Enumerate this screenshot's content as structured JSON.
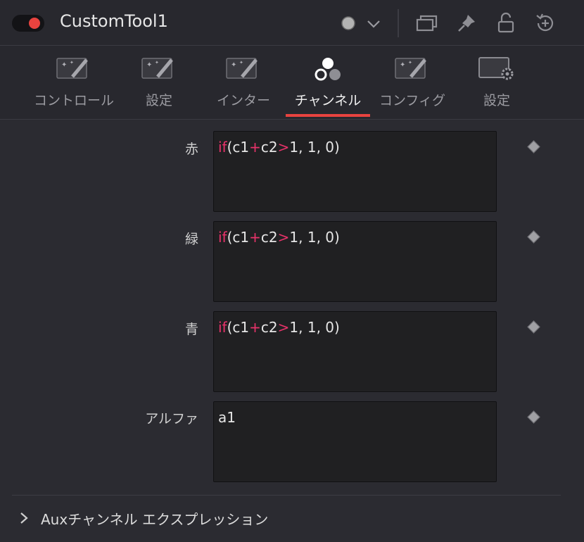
{
  "header": {
    "title": "CustomTool1",
    "power_on": true,
    "icons": [
      "power-toggle",
      "color-dot-icon",
      "chevron-down-icon",
      "window-icon",
      "pin-icon",
      "lock-icon",
      "reset-icon"
    ]
  },
  "tabs": [
    {
      "label": "コントロール",
      "icon": "magic-wand-icon",
      "active": false
    },
    {
      "label": "設定",
      "icon": "magic-wand-icon",
      "active": false
    },
    {
      "label": "インター",
      "icon": "magic-wand-icon",
      "active": false
    },
    {
      "label": "チャンネル",
      "icon": "channels-icon",
      "active": true
    },
    {
      "label": "コンフィグ",
      "icon": "magic-wand-icon",
      "active": false
    },
    {
      "label": "設定",
      "icon": "settings-monitor-icon",
      "active": false
    }
  ],
  "channels": [
    {
      "label": "赤",
      "expr": {
        "kw1": "if",
        "p1": "(c1",
        "op1": "+",
        "p2": "c2",
        "op2": ">",
        "p3": "1, 1, 0)"
      }
    },
    {
      "label": "緑",
      "expr": {
        "kw1": "if",
        "p1": "(c1",
        "op1": "+",
        "p2": "c2",
        "op2": ">",
        "p3": "1, 1, 0)"
      }
    },
    {
      "label": "青",
      "expr": {
        "kw1": "if",
        "p1": "(c1",
        "op1": "+",
        "p2": "c2",
        "op2": ">",
        "p3": "1, 1, 0)"
      }
    },
    {
      "label": "アルファ",
      "expr_plain": "a1"
    }
  ],
  "aux": {
    "label": "Auxチャンネル エクスプレッション",
    "expanded": false
  },
  "colors": {
    "accent": "#e8433f",
    "keyword": "#e8336a",
    "background": "#28282e"
  }
}
